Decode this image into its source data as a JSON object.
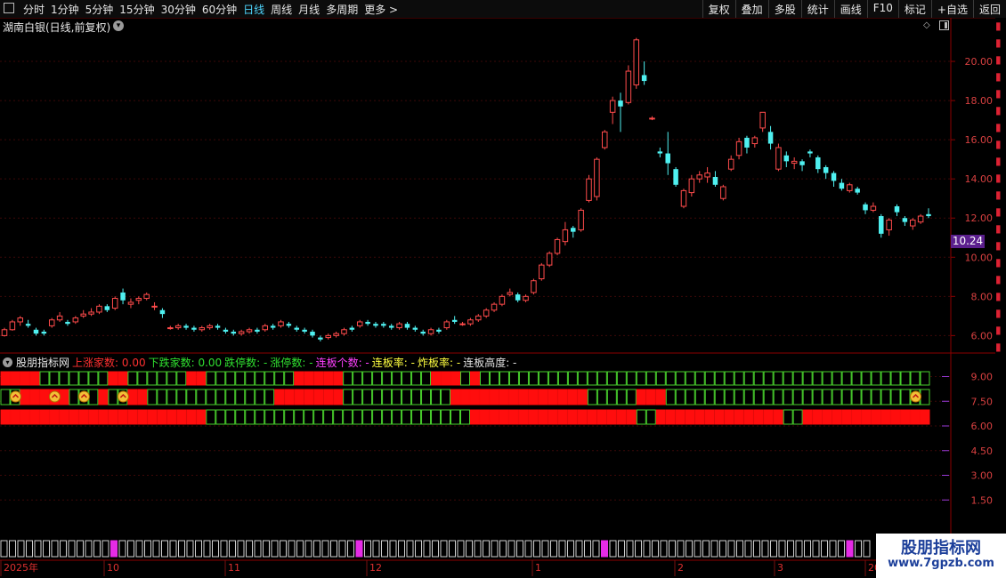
{
  "toolbar": {
    "periods": [
      "分时",
      "1分钟",
      "5分钟",
      "15分钟",
      "30分钟",
      "60分钟",
      "日线",
      "周线",
      "月线",
      "多周期",
      "更多 >"
    ],
    "active_period": "日线",
    "actions": [
      "复权",
      "叠加",
      "多股",
      "统计",
      "画线",
      "F10",
      "标记",
      "+自选",
      "返回"
    ]
  },
  "stock_title": "湖南白银(日线,前复权)",
  "price_axis": [
    "20.00",
    "18.00",
    "16.00",
    "14.00",
    "12.00",
    "10.00",
    "8.00",
    "6.00"
  ],
  "current_price": "10.24",
  "indicator": {
    "name": "股朋指标网",
    "fields": [
      {
        "label": "上涨家数: 0.00",
        "color": "#ff3030"
      },
      {
        "label": "下跌家数: 0.00",
        "color": "#30e030"
      },
      {
        "label": "跌停数: -",
        "color": "#30e030"
      },
      {
        "label": "涨停数: -",
        "color": "#30e030"
      },
      {
        "label": "连板个数: -",
        "color": "#ff40ff"
      },
      {
        "label": "连板率: -",
        "color": "#ffff40"
      },
      {
        "label": "炸板率: -",
        "color": "#ffff40"
      },
      {
        "label": "连板高度: -",
        "color": "#e0e0e0"
      }
    ],
    "axis": [
      "9.00",
      "7.50",
      "6.00",
      "4.50",
      "3.00",
      "1.50"
    ]
  },
  "date_axis": {
    "labels": [
      "2025年",
      "10",
      "11",
      "12",
      "1",
      "2",
      "3",
      "20"
    ]
  },
  "watermark": {
    "title": "股朋指标网",
    "url": "www.7gpzb.com"
  },
  "chart_data": {
    "type": "candlestick",
    "title": "湖南白银(日线,前复权)",
    "ylim": [
      5.2,
      21.5
    ],
    "current": 10.24,
    "candles": [
      [
        6.0,
        6.3,
        5.95,
        6.4
      ],
      [
        6.3,
        6.7,
        6.25,
        6.8
      ],
      [
        6.7,
        6.9,
        6.5,
        7.0
      ],
      [
        6.6,
        6.5,
        6.4,
        6.8
      ],
      [
        6.3,
        6.1,
        6.0,
        6.4
      ],
      [
        6.2,
        6.1,
        6.0,
        6.3
      ],
      [
        6.5,
        6.8,
        6.4,
        6.9
      ],
      [
        6.8,
        7.0,
        6.7,
        7.2
      ],
      [
        6.7,
        6.6,
        6.5,
        6.8
      ],
      [
        6.7,
        6.9,
        6.6,
        7.0
      ],
      [
        7.0,
        7.1,
        6.9,
        7.3
      ],
      [
        7.1,
        7.2,
        7.0,
        7.4
      ],
      [
        7.2,
        7.5,
        7.1,
        7.6
      ],
      [
        7.5,
        7.3,
        7.2,
        7.6
      ],
      [
        7.4,
        7.9,
        7.3,
        8.0
      ],
      [
        8.2,
        7.8,
        7.6,
        8.4
      ],
      [
        7.6,
        7.7,
        7.4,
        7.9
      ],
      [
        7.8,
        7.9,
        7.6,
        8.0
      ],
      [
        7.9,
        8.1,
        7.8,
        8.2
      ],
      [
        7.5,
        7.5,
        7.3,
        7.7
      ],
      [
        7.3,
        7.1,
        6.9,
        7.4
      ],
      [
        6.4,
        6.4,
        6.3,
        6.5
      ],
      [
        6.4,
        6.5,
        6.3,
        6.6
      ],
      [
        6.5,
        6.4,
        6.3,
        6.6
      ],
      [
        6.4,
        6.3,
        6.2,
        6.5
      ],
      [
        6.3,
        6.4,
        6.2,
        6.5
      ],
      [
        6.4,
        6.5,
        6.3,
        6.6
      ],
      [
        6.5,
        6.4,
        6.3,
        6.6
      ],
      [
        6.3,
        6.2,
        6.1,
        6.4
      ],
      [
        6.2,
        6.1,
        6.0,
        6.3
      ],
      [
        6.1,
        6.2,
        6.0,
        6.3
      ],
      [
        6.2,
        6.3,
        6.1,
        6.4
      ],
      [
        6.3,
        6.2,
        6.1,
        6.4
      ],
      [
        6.3,
        6.5,
        6.2,
        6.6
      ],
      [
        6.5,
        6.4,
        6.3,
        6.6
      ],
      [
        6.5,
        6.7,
        6.4,
        6.8
      ],
      [
        6.6,
        6.5,
        6.4,
        6.7
      ],
      [
        6.4,
        6.3,
        6.2,
        6.5
      ],
      [
        6.3,
        6.2,
        6.1,
        6.4
      ],
      [
        6.2,
        6.0,
        5.9,
        6.3
      ],
      [
        5.9,
        5.8,
        5.7,
        6.0
      ],
      [
        5.9,
        6.0,
        5.8,
        6.1
      ],
      [
        6.0,
        6.1,
        5.9,
        6.2
      ],
      [
        6.1,
        6.3,
        6.0,
        6.4
      ],
      [
        6.4,
        6.3,
        6.2,
        6.5
      ],
      [
        6.5,
        6.7,
        6.4,
        6.8
      ],
      [
        6.7,
        6.6,
        6.5,
        6.8
      ],
      [
        6.6,
        6.5,
        6.4,
        6.7
      ],
      [
        6.6,
        6.5,
        6.4,
        6.7
      ],
      [
        6.5,
        6.4,
        6.3,
        6.6
      ],
      [
        6.4,
        6.6,
        6.3,
        6.7
      ],
      [
        6.6,
        6.4,
        6.3,
        6.7
      ],
      [
        6.4,
        6.3,
        6.2,
        6.5
      ],
      [
        6.2,
        6.1,
        6.0,
        6.3
      ],
      [
        6.1,
        6.3,
        6.0,
        6.4
      ],
      [
        6.3,
        6.2,
        6.1,
        6.4
      ],
      [
        6.4,
        6.7,
        6.3,
        6.8
      ],
      [
        6.8,
        6.7,
        6.6,
        7.0
      ],
      [
        6.6,
        6.6,
        6.5,
        6.7
      ],
      [
        6.6,
        6.8,
        6.5,
        6.9
      ],
      [
        6.8,
        7.0,
        6.7,
        7.1
      ],
      [
        7.0,
        7.3,
        6.9,
        7.4
      ],
      [
        7.3,
        7.6,
        7.2,
        7.7
      ],
      [
        7.6,
        8.0,
        7.5,
        8.1
      ],
      [
        8.1,
        8.2,
        8.0,
        8.4
      ],
      [
        8.1,
        7.8,
        7.7,
        8.2
      ],
      [
        7.8,
        8.0,
        7.7,
        8.1
      ],
      [
        8.2,
        8.8,
        8.1,
        8.9
      ],
      [
        8.9,
        9.6,
        8.8,
        9.7
      ],
      [
        9.6,
        10.2,
        9.5,
        10.3
      ],
      [
        10.2,
        10.9,
        10.1,
        11.0
      ],
      [
        10.8,
        11.4,
        10.6,
        11.8
      ],
      [
        11.5,
        11.3,
        11.0,
        11.6
      ],
      [
        11.4,
        12.4,
        11.3,
        12.5
      ],
      [
        12.9,
        14.0,
        12.8,
        14.2
      ],
      [
        13.1,
        15.0,
        12.9,
        15.1
      ],
      [
        15.6,
        16.4,
        15.5,
        16.5
      ],
      [
        17.4,
        18.0,
        16.8,
        18.2
      ],
      [
        18.0,
        17.7,
        16.4,
        18.4
      ],
      [
        17.9,
        19.5,
        17.8,
        19.8
      ],
      [
        18.8,
        21.1,
        18.6,
        21.2
      ],
      [
        19.3,
        19.0,
        18.8,
        20.0
      ],
      [
        17.1,
        17.1,
        17.0,
        17.2
      ],
      [
        15.4,
        15.3,
        15.1,
        15.6
      ],
      [
        15.3,
        14.8,
        14.2,
        16.4
      ],
      [
        14.5,
        13.7,
        13.6,
        14.6
      ],
      [
        12.6,
        13.4,
        12.5,
        13.5
      ],
      [
        13.3,
        14.0,
        13.1,
        14.2
      ],
      [
        14.0,
        14.2,
        13.8,
        14.4
      ],
      [
        14.1,
        14.3,
        13.8,
        14.6
      ],
      [
        14.1,
        13.7,
        13.6,
        14.4
      ],
      [
        13.0,
        13.6,
        12.9,
        13.7
      ],
      [
        14.5,
        15.0,
        14.4,
        15.2
      ],
      [
        15.2,
        15.9,
        15.0,
        16.1
      ],
      [
        16.1,
        15.6,
        15.3,
        16.2
      ],
      [
        15.8,
        16.1,
        15.6,
        16.2
      ],
      [
        16.6,
        17.4,
        16.4,
        17.4
      ],
      [
        16.4,
        15.8,
        15.5,
        16.7
      ],
      [
        14.5,
        15.6,
        14.4,
        15.8
      ],
      [
        15.2,
        14.9,
        14.6,
        15.4
      ],
      [
        14.8,
        14.9,
        14.5,
        15.1
      ],
      [
        14.9,
        14.7,
        14.4,
        15.0
      ],
      [
        15.4,
        15.3,
        15.1,
        15.5
      ],
      [
        15.1,
        14.5,
        14.3,
        15.2
      ],
      [
        14.6,
        14.3,
        14.0,
        14.7
      ],
      [
        14.3,
        13.9,
        13.6,
        14.4
      ],
      [
        13.8,
        13.5,
        13.4,
        14.0
      ],
      [
        13.4,
        13.7,
        13.3,
        13.8
      ],
      [
        13.5,
        13.3,
        13.2,
        13.6
      ],
      [
        12.7,
        12.4,
        12.2,
        12.8
      ],
      [
        12.4,
        12.6,
        12.3,
        12.8
      ],
      [
        12.1,
        11.2,
        11.0,
        12.2
      ],
      [
        11.4,
        11.9,
        11.1,
        12.0
      ],
      [
        12.6,
        12.3,
        12.1,
        12.7
      ],
      [
        12.0,
        11.8,
        11.6,
        12.1
      ],
      [
        11.6,
        11.9,
        11.4,
        12.0
      ],
      [
        11.8,
        12.1,
        11.7,
        12.2
      ],
      [
        12.2,
        12.1,
        12.0,
        12.5
      ]
    ]
  }
}
